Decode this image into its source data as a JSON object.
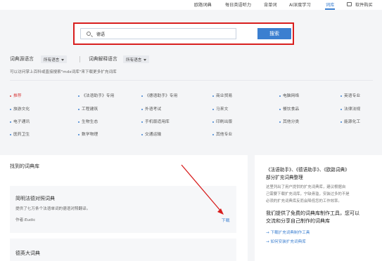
{
  "nav": {
    "items": [
      "欧路词典",
      "每日英语听力",
      "背单词",
      "AI深度学习",
      "词库"
    ],
    "active_index": 4,
    "buy": "软件购买"
  },
  "search": {
    "query": "德语",
    "button": "搜索"
  },
  "filters": {
    "source_label": "词典源语言",
    "source_value": "所有语言",
    "target_label": "词典解释语言",
    "target_value": "所有语言",
    "hint": "可以访问掌上百科或直接搜索\"mdx词库\"来下载更多扩充词库"
  },
  "categories": [
    "推荐",
    "《法语助手》专用",
    "《德语助手》专用",
    "商业贸易",
    "电脑网络",
    "英语专业",
    "旅游文化",
    "工程建筑",
    "外语考试",
    "马来文",
    "餐饮食品",
    "法律法规",
    "电子通讯",
    "生物生态",
    "手机版适用库",
    "印刷出版",
    "其他分类",
    "能源化工",
    "医药卫生",
    "数学物理",
    "交通运输",
    "其他专业"
  ],
  "results": {
    "title": "找到的词典库",
    "items": [
      {
        "name": "简明法德对照词典",
        "desc": "提供了七万条个法语单词的德语对照翻译。",
        "author": "作者:Eudic",
        "download": "下载"
      },
      {
        "name": "德英大词典"
      }
    ]
  },
  "side": {
    "title1": "《法语助手》、《德语助手》、《欧路词典》",
    "title2": "部分扩充词典整理",
    "text1": "这里列出了用户提供的扩充词典库，建议根据自",
    "text2": "己需要下载扩充词库，宁缺毋滥，安装过多的不是",
    "text3": "必须的扩充词典库反而会降低您的工作效率。",
    "big1": "我们提供了免费的词典库制作工具，您可以",
    "big2": "交流和分享自己制作的词典库",
    "link1": "→ 下载扩充词典制作工具",
    "link2": "→ 如何安装扩充词典库"
  },
  "colors": {
    "accent": "#3b7fd0",
    "highlight_box": "#d81e1e",
    "annotation_arrow": "#d81e1e"
  }
}
